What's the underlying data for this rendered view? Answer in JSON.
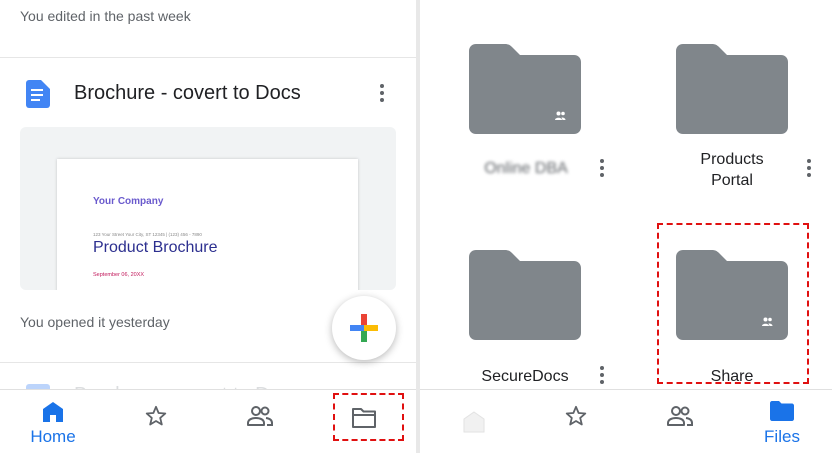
{
  "left": {
    "section_week": "You edited in the past week",
    "doc": {
      "title": "Brochure - covert to Docs",
      "icon": "docs-icon"
    },
    "thumbnail": {
      "company": "Your Company",
      "address": "123 Your Street Your City, ST 12345 | (123) 456 - 7890",
      "heading": "Product Brochure",
      "date": "September 06, 20XX"
    },
    "section_yesterday": "You opened it yesterday",
    "ghost_doc_title": "Brochure - covert to Docs"
  },
  "left_nav": {
    "home_label": "Home",
    "active_color": "#1a73e8"
  },
  "right": {
    "folders": [
      {
        "name": "Online DBA",
        "shared": true
      },
      {
        "name": "Products Portal",
        "shared": false
      },
      {
        "name": "SecureDocs",
        "shared": false
      },
      {
        "name": "Share",
        "shared": true
      }
    ],
    "folder_color": "#80868b"
  },
  "right_nav": {
    "files_label": "Files"
  },
  "highlight_color": "#e01010"
}
